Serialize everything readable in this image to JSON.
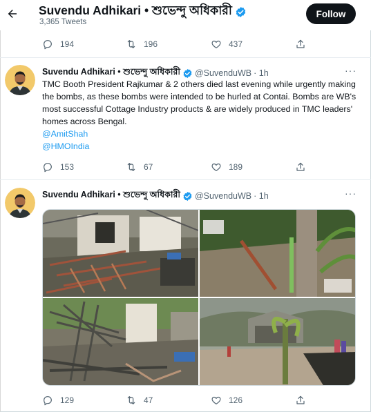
{
  "header": {
    "profile_name": "Suvendu Adhikari • শুভেন্দু অধিকারী",
    "tweet_count": "3,365 Tweets",
    "follow_label": "Follow"
  },
  "prev_actions": {
    "replies": "194",
    "retweets": "196",
    "likes": "437"
  },
  "tweet1": {
    "name": "Suvendu Adhikari • শুভেন্দু অধিকারী",
    "handle": "@SuvenduWB",
    "time": "· 1h",
    "text": "TMC Booth President Rajkumar & 2 others died last evening while urgently making the bombs, as these bombs were intended to be hurled at Contai. Bombs are WB's most successful Cottage Industry products & are widely produced in TMC leaders' homes across Bengal.",
    "mention1": "@AmitShah",
    "mention2": "@HMOIndia",
    "replies": "153",
    "retweets": "67",
    "likes": "189"
  },
  "tweet2": {
    "name": "Suvendu Adhikari • শুভেন্দু অধিকারী",
    "handle": "@SuvenduWB",
    "time": "· 1h",
    "replies": "129",
    "retweets": "47",
    "likes": "126"
  },
  "more_label": "···",
  "colors": {
    "accent": "#1d9bf0",
    "text": "#0f1419",
    "muted": "#536471",
    "follow_bg": "#0f1419"
  },
  "icons": [
    "back-arrow-icon",
    "verified-badge-icon",
    "reply-icon",
    "retweet-icon",
    "like-icon",
    "share-icon",
    "more-icon"
  ]
}
